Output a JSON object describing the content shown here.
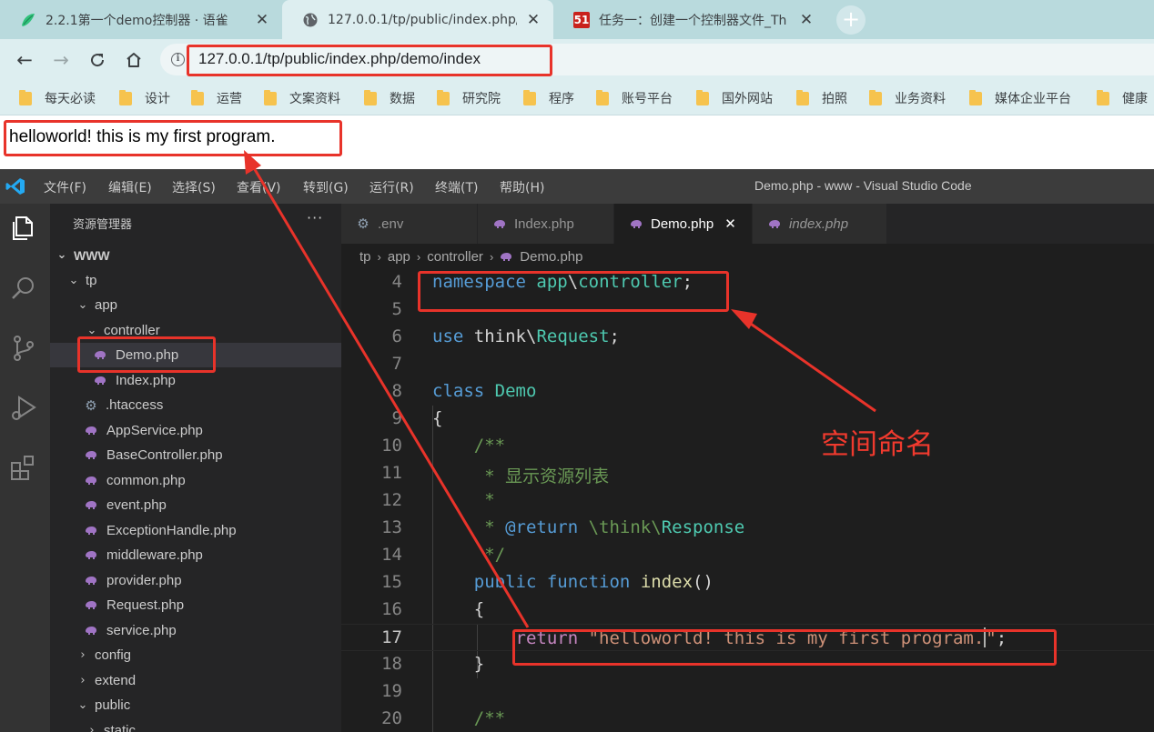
{
  "browser": {
    "tabs": [
      {
        "title": "2.2.1第一个demo控制器 · 语雀",
        "icon": "yuque-icon"
      },
      {
        "title": "127.0.0.1/tp/public/index.php/",
        "icon": "globe-icon",
        "active": true
      },
      {
        "title": "任务一：创建一个控制器文件_Th",
        "icon": "51cto-icon",
        "badge": "51"
      }
    ],
    "new_tab": "+",
    "url": "127.0.0.1/tp/public/index.php/demo/index",
    "bookmarks": [
      "每天必读",
      "设计",
      "运营",
      "文案资料",
      "数据",
      "研究院",
      "程序",
      "账号平台",
      "国外网站",
      "拍照",
      "业务资料",
      "媒体企业平台",
      "健康"
    ]
  },
  "page": {
    "output": "helloworld!  this is my first program."
  },
  "vscode": {
    "menu": [
      "文件(F)",
      "编辑(E)",
      "选择(S)",
      "查看(V)",
      "转到(G)",
      "运行(R)",
      "终端(T)",
      "帮助(H)"
    ],
    "window_title": "Demo.php - www - Visual Studio Code",
    "explorer": {
      "header": "资源管理器",
      "more": "···",
      "tree": [
        {
          "label": "WWW",
          "type": "folder",
          "depth": 0
        },
        {
          "label": "tp",
          "type": "folder",
          "depth": 1
        },
        {
          "label": "app",
          "type": "folder",
          "depth": 2
        },
        {
          "label": "controller",
          "type": "folder",
          "depth": 3
        },
        {
          "label": "Demo.php",
          "type": "php",
          "depth": 4,
          "selected": true
        },
        {
          "label": "Index.php",
          "type": "php",
          "depth": 4
        },
        {
          "label": ".htaccess",
          "type": "config",
          "depth": 3
        },
        {
          "label": "AppService.php",
          "type": "php",
          "depth": 3
        },
        {
          "label": "BaseController.php",
          "type": "php",
          "depth": 3
        },
        {
          "label": "common.php",
          "type": "php",
          "depth": 3
        },
        {
          "label": "event.php",
          "type": "php",
          "depth": 3
        },
        {
          "label": "ExceptionHandle.php",
          "type": "php",
          "depth": 3
        },
        {
          "label": "middleware.php",
          "type": "php",
          "depth": 3
        },
        {
          "label": "provider.php",
          "type": "php",
          "depth": 3
        },
        {
          "label": "Request.php",
          "type": "php",
          "depth": 3
        },
        {
          "label": "service.php",
          "type": "php",
          "depth": 3
        },
        {
          "label": "config",
          "type": "folder-collapsed",
          "depth": 2
        },
        {
          "label": "extend",
          "type": "folder-collapsed",
          "depth": 2
        },
        {
          "label": "public",
          "type": "folder",
          "depth": 2
        },
        {
          "label": "static",
          "type": "folder-collapsed",
          "depth": 3
        }
      ]
    },
    "editor_tabs": [
      {
        "label": ".env",
        "icon": "gear-icon"
      },
      {
        "label": "Index.php",
        "icon": "php-icon"
      },
      {
        "label": "Demo.php",
        "icon": "php-icon",
        "active": true,
        "close": "✕"
      },
      {
        "label": "index.php",
        "icon": "php-icon",
        "italic": true
      }
    ],
    "breadcrumb": [
      "tp",
      "app",
      "controller",
      "Demo.php"
    ],
    "current_line": 17,
    "code": [
      {
        "n": "4",
        "tokens": [
          [
            "kw",
            "namespace"
          ],
          [
            "",
            " "
          ],
          [
            "ns",
            "app"
          ],
          [
            "",
            "\\"
          ],
          [
            "ns",
            "controller"
          ],
          [
            "",
            ";"
          ]
        ]
      },
      {
        "n": "5",
        "tokens": []
      },
      {
        "n": "6",
        "tokens": [
          [
            "kw",
            "use"
          ],
          [
            "",
            " "
          ],
          [
            "",
            "think"
          ],
          [
            "",
            "\\"
          ],
          [
            "cls",
            "Request"
          ],
          [
            "",
            ";"
          ]
        ]
      },
      {
        "n": "7",
        "tokens": []
      },
      {
        "n": "8",
        "tokens": [
          [
            "kw",
            "class"
          ],
          [
            "",
            " "
          ],
          [
            "cls",
            "Demo"
          ]
        ]
      },
      {
        "n": "9",
        "tokens": [
          [
            "",
            "{"
          ]
        ]
      },
      {
        "n": "10",
        "tokens": [
          [
            "cm",
            "    /**"
          ]
        ]
      },
      {
        "n": "11",
        "tokens": [
          [
            "cm",
            "     * 显示资源列表"
          ]
        ]
      },
      {
        "n": "12",
        "tokens": [
          [
            "cm",
            "     *"
          ]
        ]
      },
      {
        "n": "13",
        "tokens": [
          [
            "cm",
            "     * "
          ],
          [
            "kw",
            "@return"
          ],
          [
            "cm",
            " "
          ],
          [
            "cm",
            "\\think\\"
          ],
          [
            "cls",
            "Response"
          ]
        ]
      },
      {
        "n": "14",
        "tokens": [
          [
            "cm",
            "     */"
          ]
        ]
      },
      {
        "n": "15",
        "tokens": [
          [
            "",
            "    "
          ],
          [
            "kw",
            "public"
          ],
          [
            "",
            " "
          ],
          [
            "kw",
            "function"
          ],
          [
            "",
            " "
          ],
          [
            "fn",
            "index"
          ],
          [
            "",
            "()"
          ]
        ]
      },
      {
        "n": "16",
        "tokens": [
          [
            "",
            "    {"
          ]
        ]
      },
      {
        "n": "17",
        "tokens": [
          [
            "",
            "        "
          ],
          [
            "kw2",
            "return"
          ],
          [
            "",
            " "
          ],
          [
            "str",
            "\"helloworld! this is my first program."
          ],
          [
            "cursor",
            ""
          ],
          [
            "str",
            "\""
          ],
          [
            "",
            ";"
          ]
        ]
      },
      {
        "n": "18",
        "tokens": [
          [
            "",
            "    }"
          ]
        ]
      },
      {
        "n": "19",
        "tokens": []
      },
      {
        "n": "20",
        "tokens": [
          [
            "cm",
            "    /**"
          ]
        ]
      }
    ]
  },
  "annotation": {
    "label": "空间命名",
    "color": "#e8332a"
  }
}
